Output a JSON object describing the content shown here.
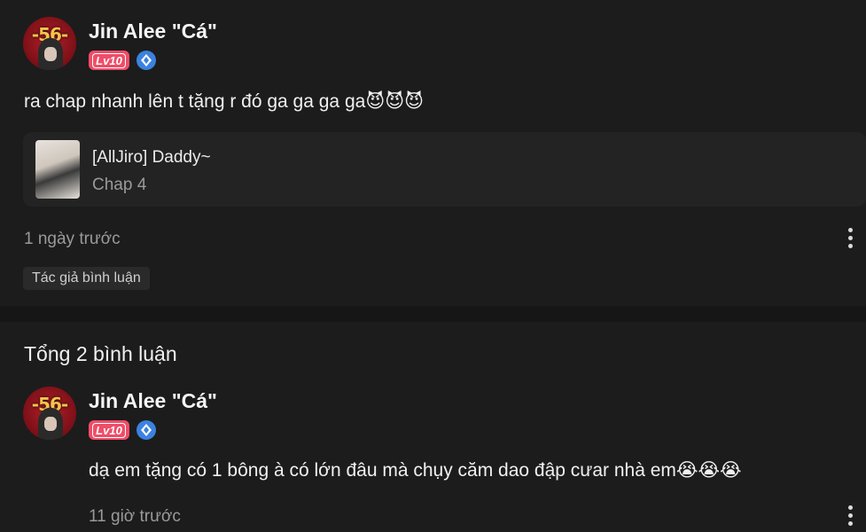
{
  "post": {
    "user": {
      "name": "Jin Alee \"Cá\"",
      "level": "Lv10",
      "avatar_text": "-56-"
    },
    "comment": "ra chap nhanh lên t tặng r đó ga ga ga ga",
    "emojis": "😈😈😈",
    "chapter": {
      "series": "[AllJiro] Daddy~",
      "chap": "Chap 4"
    },
    "time": "1 ngày trước",
    "author_tag": "Tác giả bình luận"
  },
  "replies": {
    "total_label": "Tổng 2 bình luận",
    "items": [
      {
        "user": {
          "name": "Jin Alee \"Cá\"",
          "level": "Lv10",
          "avatar_text": "-56-"
        },
        "comment": "dạ em tặng có 1 bông à có lớn đâu mà chụy căm dao đập cưar nhà em",
        "emojis": "😭😭😭",
        "time": "11 giờ trước"
      }
    ]
  },
  "colors": {
    "background": "#1c1c1c",
    "level_badge": "#ef4d68",
    "rank_icon": "#3b82e0"
  },
  "icons": {
    "rank": "rank-badge-icon",
    "more": "more-vertical-icon"
  }
}
